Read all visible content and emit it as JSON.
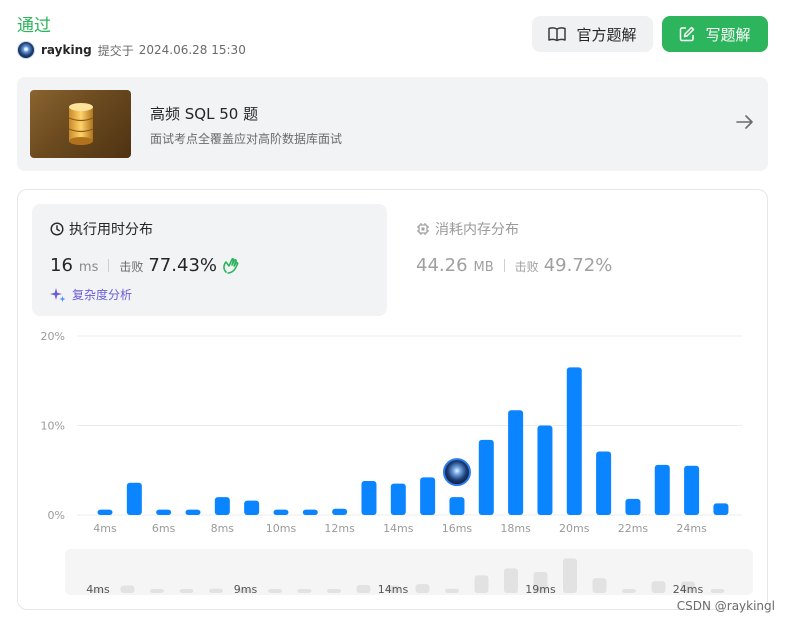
{
  "status": "通过",
  "submission": {
    "user": "rayking",
    "submitted_text": "提交于",
    "time": "2024.06.28 15:30"
  },
  "buttons": {
    "official": "官方题解",
    "write": "写题解"
  },
  "study_plan": {
    "title": "高频 SQL 50 题",
    "subtitle": "面试考点全覆盖应对高阶数据库面试"
  },
  "runtime": {
    "title": "执行用时分布",
    "value": "16",
    "unit": "ms",
    "beat_label": "击败",
    "beat_pct": "77.43%",
    "complexity_label": "复杂度分析"
  },
  "memory": {
    "title": "消耗内存分布",
    "value": "44.26",
    "unit": "MB",
    "beat_label": "击败",
    "beat_pct": "49.72%"
  },
  "colors": {
    "accent_green": "#2db55d",
    "bar_blue": "#0a84ff",
    "ai_purple": "#6a5ddb"
  },
  "chart_data": {
    "type": "bar",
    "y_ticks": [
      "20%",
      "10%",
      "0%"
    ],
    "ylim": [
      0,
      20
    ],
    "x_tick_labels": [
      "4ms",
      "6ms",
      "8ms",
      "10ms",
      "12ms",
      "14ms",
      "16ms",
      "18ms",
      "20ms",
      "22ms",
      "24ms"
    ],
    "x": [
      4,
      5,
      6,
      7,
      8,
      9,
      10,
      11,
      12,
      13,
      14,
      15,
      16,
      17,
      18,
      19,
      20,
      21,
      22,
      23,
      24,
      25
    ],
    "values": [
      0.6,
      3.6,
      0.6,
      0.6,
      2.0,
      1.6,
      0.6,
      0.6,
      0.7,
      3.8,
      3.5,
      4.2,
      2.0,
      8.4,
      11.7,
      10.0,
      16.5,
      7.1,
      1.8,
      5.6,
      5.5,
      1.3
    ],
    "highlight_x": 16,
    "navigator_labels": [
      "4ms",
      "9ms",
      "14ms",
      "19ms",
      "24ms"
    ]
  },
  "watermark": "CSDN @raykingl"
}
